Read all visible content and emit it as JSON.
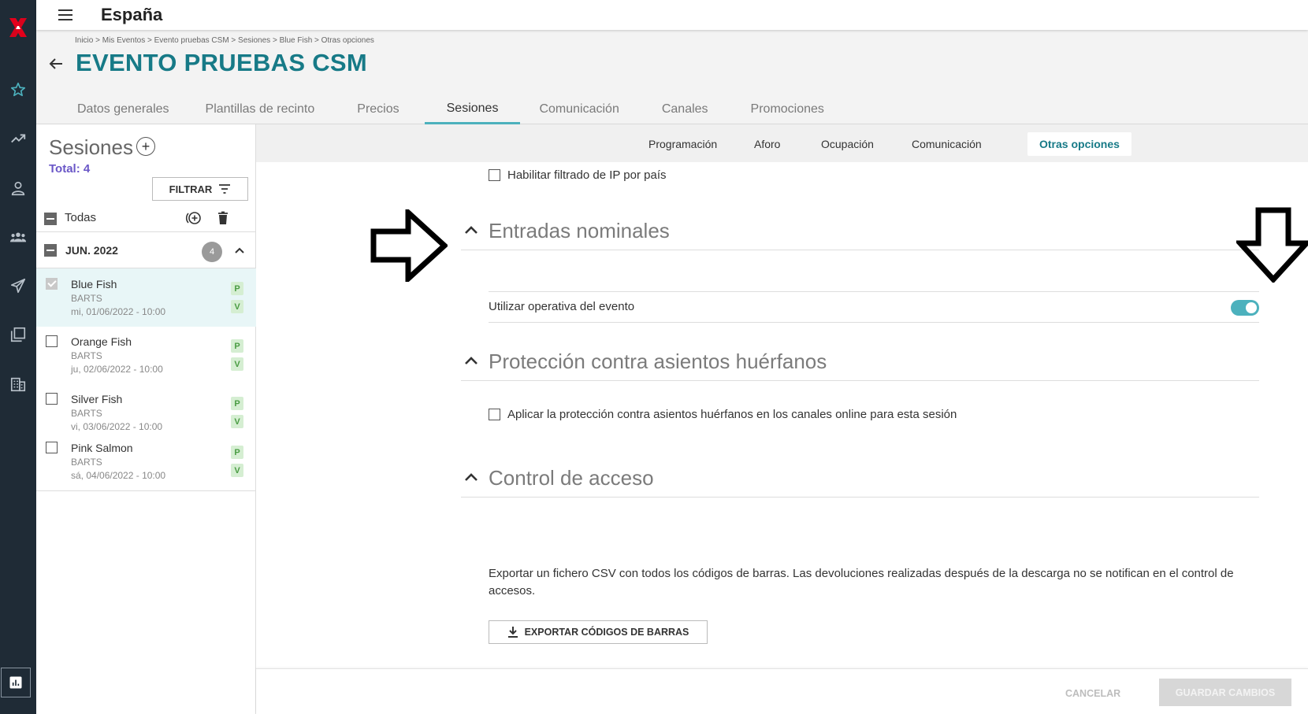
{
  "app": {
    "country": "España"
  },
  "breadcrumb": "Inicio > Mis Eventos > Evento pruebas CSM > Sesiones > Blue Fish > Otras opciones",
  "event_title": "EVENTO PRUEBAS CSM",
  "tabs": [
    {
      "label": "Datos generales"
    },
    {
      "label": "Plantillas de recinto"
    },
    {
      "label": "Precios"
    },
    {
      "label": "Sesiones"
    },
    {
      "label": "Comunicación"
    },
    {
      "label": "Canales"
    },
    {
      "label": "Promociones"
    }
  ],
  "active_tab": "Sesiones",
  "sessions": {
    "title": "Sesiones",
    "total": "Total: 4",
    "filter_label": "FILTRAR",
    "all_label": "Todas",
    "month": {
      "label": "JUN. 2022",
      "count": "4"
    },
    "items": [
      {
        "name": "Blue Fish",
        "venue": "BARTS",
        "date": "mi, 01/06/2022 - 10:00",
        "tags": [
          "P",
          "V"
        ]
      },
      {
        "name": "Orange Fish",
        "venue": "BARTS",
        "date": "ju, 02/06/2022 - 10:00",
        "tags": [
          "P",
          "V"
        ]
      },
      {
        "name": "Silver Fish",
        "venue": "BARTS",
        "date": "vi, 03/06/2022 - 10:00",
        "tags": [
          "P",
          "V"
        ]
      },
      {
        "name": "Pink Salmon",
        "venue": "BARTS",
        "date": "sá, 04/06/2022 - 10:00",
        "tags": [
          "P",
          "V"
        ]
      }
    ]
  },
  "subtabs": [
    {
      "label": "Programación"
    },
    {
      "label": "Aforo"
    },
    {
      "label": "Ocupación"
    },
    {
      "label": "Comunicación"
    },
    {
      "label": "Otras opciones"
    }
  ],
  "active_subtab": "Otras opciones",
  "content": {
    "ip_filter_label": "Habilitar filtrado de IP por país",
    "sections": {
      "nominal": {
        "title": "Entradas nominales",
        "toggle_label": "Utilizar operativa del evento",
        "toggle_on": true
      },
      "orphan": {
        "title": "Protección contra asientos huérfanos",
        "checkbox_label": "Aplicar la protección contra asientos huérfanos en los canales online para esta sesión"
      },
      "access": {
        "title": "Control de acceso",
        "description": "Exportar un fichero CSV con todos los códigos de barras. Las devoluciones realizadas después de la descarga no se notifican en el control de accesos.",
        "export_label": "EXPORTAR CÓDIGOS DE BARRAS"
      }
    }
  },
  "footer": {
    "cancel_label": "CANCELAR",
    "save_label": "GUARDAR CAMBIOS"
  },
  "colors": {
    "accent": "#177a87",
    "toggle": "#4cb1bd",
    "rail": "#1f2b36",
    "total": "#6a57c7",
    "logo_red": "#e3001b"
  }
}
